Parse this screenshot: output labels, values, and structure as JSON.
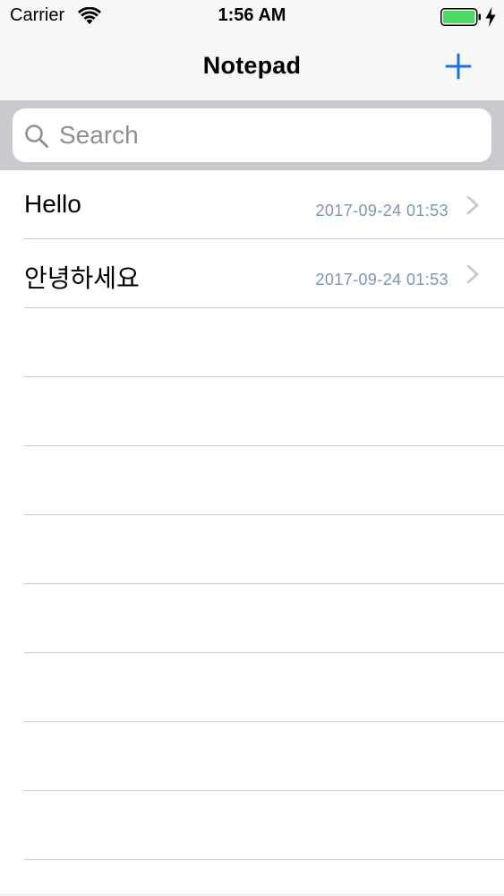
{
  "status_bar": {
    "carrier": "Carrier",
    "time": "1:56 AM",
    "battery_level": 1.0,
    "charging": true,
    "wifi_icon": "wifi-icon",
    "battery_icon": "battery-icon",
    "battery_color": "#4cd964"
  },
  "nav": {
    "title": "Notepad",
    "add_icon": "plus-icon",
    "accent_color": "#1a73e8"
  },
  "search": {
    "placeholder": "Search",
    "value": "",
    "icon": "search-icon"
  },
  "notes": [
    {
      "title": "Hello",
      "date": "2017-09-24 01:53"
    },
    {
      "title": "안녕하세요",
      "date": "2017-09-24 01:53"
    }
  ],
  "colors": {
    "date_text": "#7d95b5",
    "separator": "#c8c7cc",
    "search_bar_bg": "#c9c9ce"
  }
}
